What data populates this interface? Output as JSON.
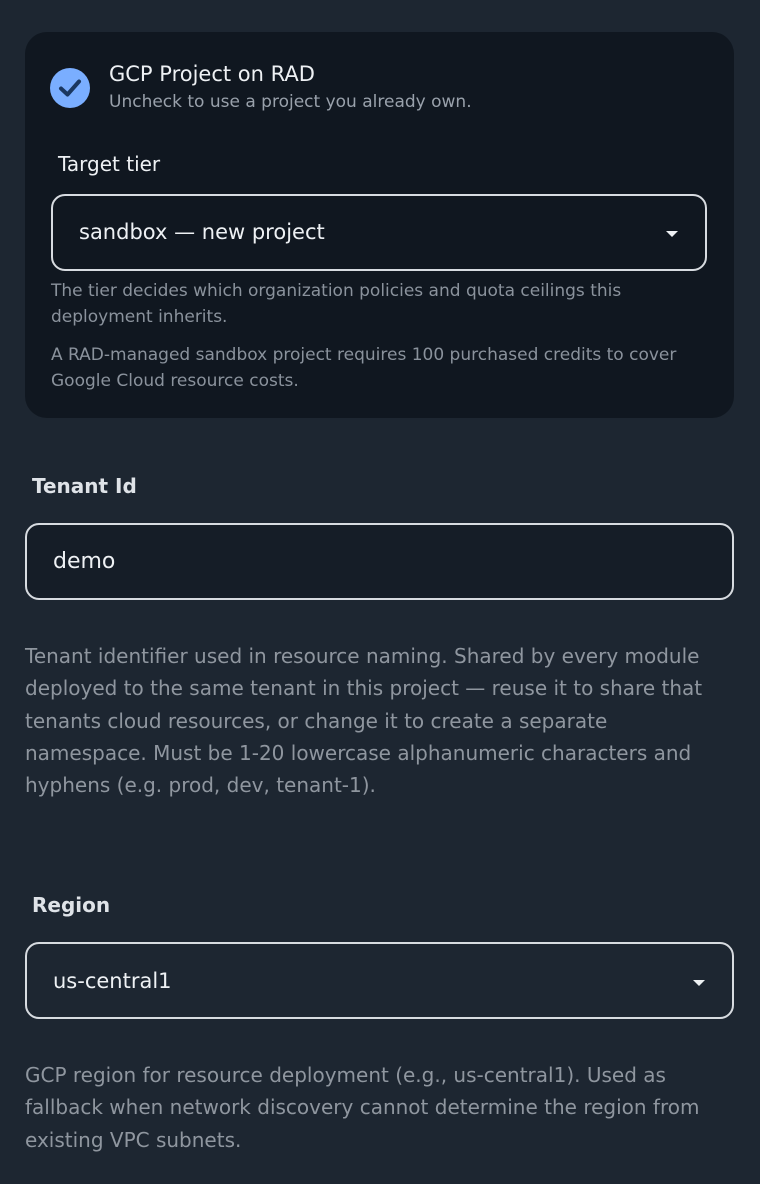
{
  "gcp_card": {
    "checkbox_checked": true,
    "checkbox_color": "#7aaeff",
    "checkbox_title": "GCP Project on RAD",
    "checkbox_subtitle": "Uncheck to use a project you already own.",
    "tier_label": "Target tier",
    "tier_value": "sandbox — new project",
    "tier_help": "The tier decides which organization policies and quota ceilings this deployment inherits.",
    "credits_help": "A RAD-managed sandbox project requires 100 purchased credits to cover Google Cloud resource costs."
  },
  "tenant": {
    "label": "Tenant Id",
    "value": "demo",
    "help": "Tenant identifier used in resource naming. Shared by every module deployed to the same tenant in this project — reuse it to share that tenants cloud resources, or change it to create a separate namespace. Must be 1-20 lowercase alphanumeric characters and hyphens (e.g. prod, dev, tenant-1)."
  },
  "region": {
    "label": "Region",
    "value": "us-central1",
    "help": "GCP region for resource deployment (e.g., us-central1). Used as fallback when network discovery cannot determine the region from existing VPC subnets."
  },
  "icons": {
    "checkbox": "checkmark-icon",
    "dropdown": "caret-down-icon"
  }
}
